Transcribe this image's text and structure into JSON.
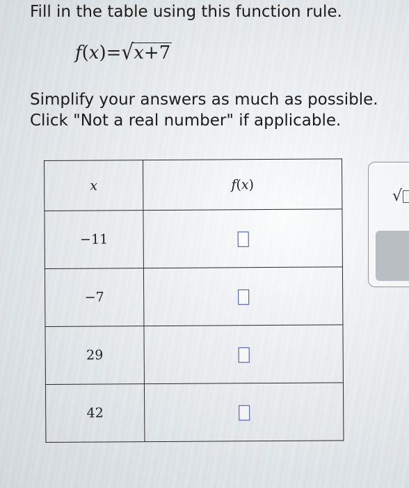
{
  "instructions": {
    "line1": "Fill in the table using this function rule.",
    "line2": "Simplify your answers as much as possible.",
    "line3": "Click \"Not a real number\" if applicable."
  },
  "formula": {
    "fn": "f",
    "open": "(",
    "var": "x",
    "close": ")",
    "equals": "=",
    "sqrt": "√",
    "radicand_var": "x",
    "radicand_rest": "+7"
  },
  "table": {
    "header_x": "x",
    "header_fx": {
      "fn": "f",
      "open": "(",
      "var": "x",
      "close": ")"
    },
    "rows": [
      {
        "x": "−11",
        "answer": ""
      },
      {
        "x": "−7",
        "answer": ""
      },
      {
        "x": "29",
        "answer": ""
      },
      {
        "x": "42",
        "answer": ""
      }
    ]
  },
  "tools": {
    "sqrt": "√"
  },
  "colors": {
    "answer_box_border": "#3b4aa8"
  }
}
